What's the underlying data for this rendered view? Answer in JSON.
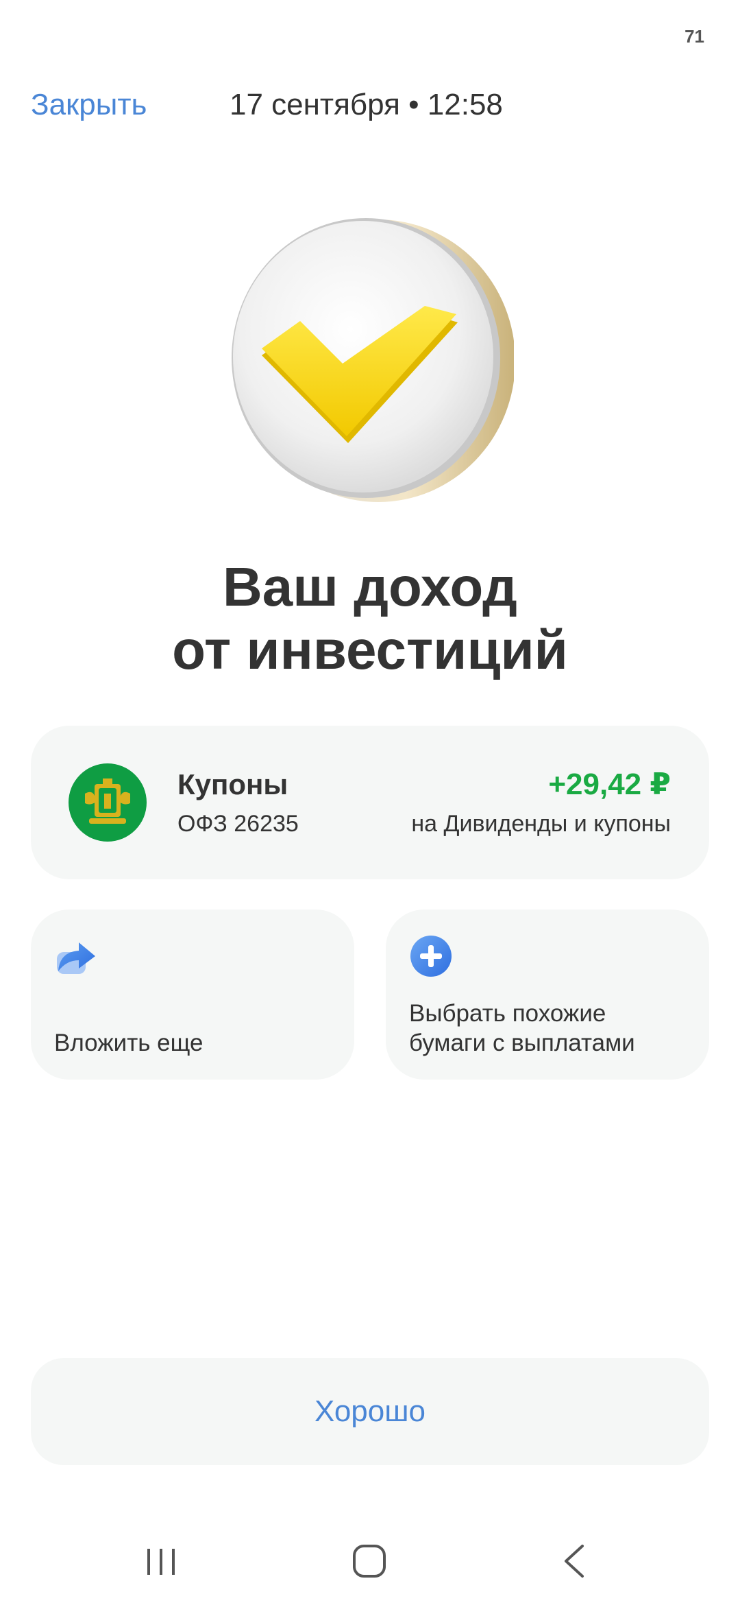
{
  "status_bar": {
    "battery": "71"
  },
  "header": {
    "close_label": "Закрыть",
    "datetime": "17 сентября • 12:58"
  },
  "hero": {
    "icon": "yellow-checkmark-coin"
  },
  "headline": {
    "line1": "Ваш доход",
    "line2": "от инвестиций"
  },
  "income": {
    "logo": "issuer-emblem-icon",
    "title": "Купоны",
    "subtitle": "ОФЗ 26235",
    "amount": "+29,42 ₽",
    "target": "на Дивиденды и купоны"
  },
  "actions": [
    {
      "icon": "share-arrow-icon",
      "label": "Вложить еще"
    },
    {
      "icon": "plus-circle-icon",
      "label_line1": "Выбрать похожие",
      "label_line2": "бумаги с выплатами"
    }
  ],
  "ok_label": "Хорошо",
  "colors": {
    "accent": "#4a86d6",
    "positive": "#1aaa43",
    "card_bg": "#f5f7f6",
    "check": "#f5d800"
  }
}
